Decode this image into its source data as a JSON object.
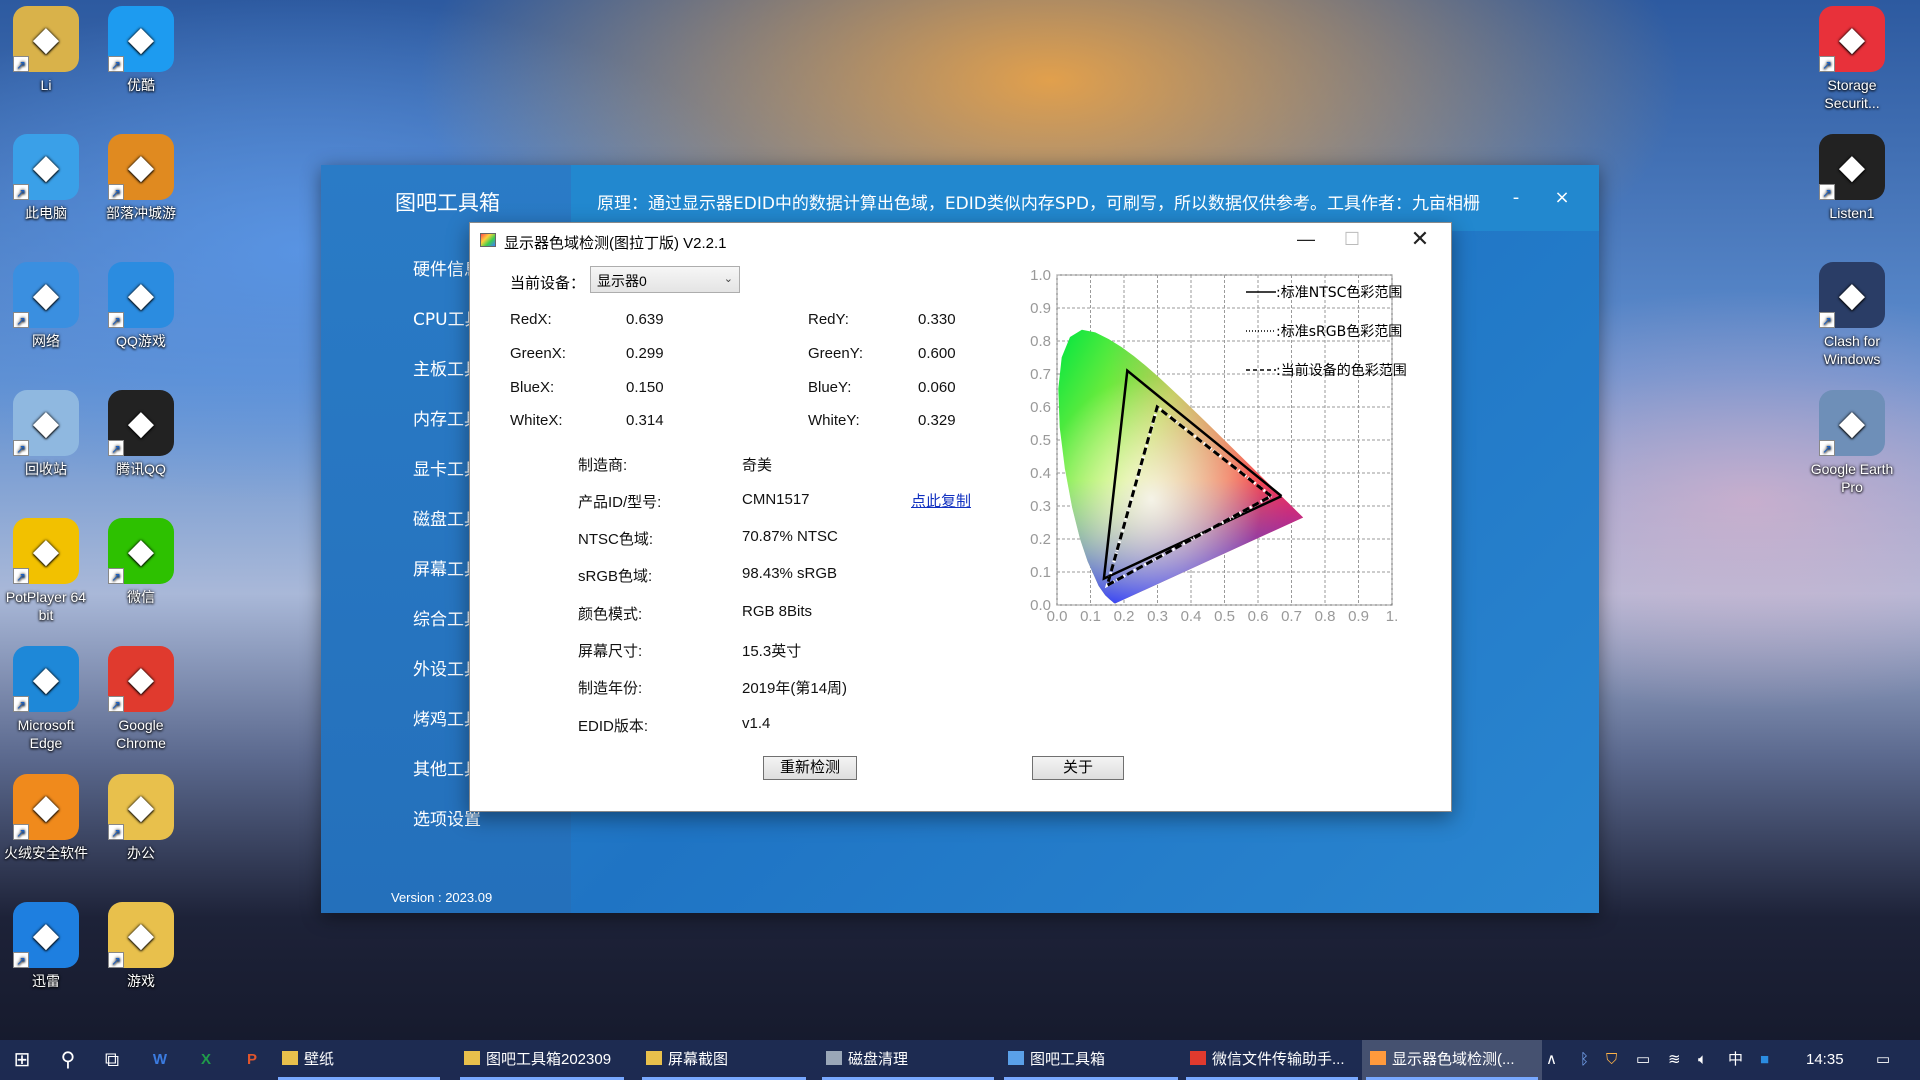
{
  "desktop": {
    "icons": [
      {
        "label": "Li",
        "icon": "user-folder-icon",
        "color": "#d9b24a"
      },
      {
        "label": "优酷",
        "icon": "youku-icon",
        "color": "#1d9bf0"
      },
      {
        "label": "此电脑",
        "icon": "computer-icon",
        "color": "#3aa0e8"
      },
      {
        "label": "部落冲城游",
        "icon": "game-icon",
        "color": "#e08a20"
      },
      {
        "label": "网络",
        "icon": "network-icon",
        "color": "#3a8fe0"
      },
      {
        "label": "QQ游戏",
        "icon": "qq-game-icon",
        "color": "#2b8ce0"
      },
      {
        "label": "回收站",
        "icon": "recycle-bin-icon",
        "color": "#8fb8e0"
      },
      {
        "label": "腾讯QQ",
        "icon": "qq-icon",
        "color": "#222222"
      },
      {
        "label": "PotPlayer 64 bit",
        "icon": "potplayer-icon",
        "color": "#f2c100"
      },
      {
        "label": "微信",
        "icon": "wechat-icon",
        "color": "#2dc100"
      },
      {
        "label": "Microsoft Edge",
        "icon": "edge-icon",
        "color": "#1e88d8"
      },
      {
        "label": "Google Chrome",
        "icon": "chrome-icon",
        "color": "#e03a2e"
      },
      {
        "label": "火绒安全软件",
        "icon": "huorong-icon",
        "color": "#f08a1c"
      },
      {
        "label": "办公",
        "icon": "folder-icon",
        "color": "#e8c04c"
      },
      {
        "label": "迅雷",
        "icon": "xunlei-icon",
        "color": "#1e7fe0"
      },
      {
        "label": "游戏",
        "icon": "folder-icon",
        "color": "#e8c04c"
      },
      {
        "label": "Storage Securit...",
        "icon": "storage-security-icon",
        "color": "#e8313a"
      },
      {
        "label": "Listen1",
        "icon": "listen1-icon",
        "color": "#222222"
      },
      {
        "label": "Clash for Windows",
        "icon": "clash-icon",
        "color": "#2a3d66"
      },
      {
        "label": "Google Earth Pro",
        "icon": "google-earth-icon",
        "color": "#6e8fb8"
      }
    ]
  },
  "toolbox": {
    "title": "图吧工具箱",
    "notice": "原理：通过显示器EDID中的数据计算出色域，EDID类似内存SPD，可刷写，所以数据仅供参考。工具作者：九亩相栅",
    "minimize": "-",
    "close": "×",
    "version": "Version : 2023.09",
    "nav": [
      "硬件信息",
      "CPU工具",
      "主板工具",
      "内存工具",
      "显卡工具",
      "磁盘工具",
      "屏幕工具",
      "综合工具",
      "外设工具",
      "烤鸡工具",
      "其他工具",
      "选项设置"
    ]
  },
  "dialog": {
    "title": "显示器色域检测(图拉丁版) V2.2.1",
    "controls": {
      "minimize": "—",
      "maximize": "☐",
      "close": "✕"
    },
    "device_label": "当前设备：",
    "device_value": "显示器0",
    "coords": [
      {
        "label": "RedX:",
        "value": "0.639"
      },
      {
        "label": "RedY:",
        "value": "0.330"
      },
      {
        "label": "GreenX:",
        "value": "0.299"
      },
      {
        "label": "GreenY:",
        "value": "0.600"
      },
      {
        "label": "BlueX:",
        "value": "0.150"
      },
      {
        "label": "BlueY:",
        "value": "0.060"
      },
      {
        "label": "WhiteX:",
        "value": "0.314"
      },
      {
        "label": "WhiteY:",
        "value": "0.329"
      }
    ],
    "info": [
      {
        "label": "制造商:",
        "value": "奇美"
      },
      {
        "label": "产品ID/型号:",
        "value": "CMN1517"
      },
      {
        "label": "NTSC色域:",
        "value": "70.87% NTSC"
      },
      {
        "label": "sRGB色域:",
        "value": "98.43% sRGB"
      },
      {
        "label": "颜色模式:",
        "value": "RGB 8Bits"
      },
      {
        "label": "屏幕尺寸:",
        "value": "15.3英寸"
      },
      {
        "label": "制造年份:",
        "value": "2019年(第14周)"
      },
      {
        "label": "EDID版本:",
        "value": "v1.4"
      }
    ],
    "copy_link": "点此复制",
    "recheck_button": "重新检测",
    "about_button": "关于"
  },
  "chart_data": {
    "type": "scatter",
    "title": "",
    "xlabel": "",
    "ylabel": "",
    "xlim": [
      0,
      1
    ],
    "ylim": [
      0,
      1
    ],
    "x_ticks": [
      "0.0",
      "0.1",
      "0.2",
      "0.3",
      "0.4",
      "0.5",
      "0.6",
      "0.7",
      "0.8",
      "0.9",
      "1."
    ],
    "y_ticks": [
      "0.0",
      "0.1",
      "0.2",
      "0.3",
      "0.4",
      "0.5",
      "0.6",
      "0.7",
      "0.8",
      "0.9",
      "1.0"
    ],
    "grid": true,
    "legend_position": "top-right",
    "series": [
      {
        "name": ":标准NTSC色彩范围",
        "style": "solid",
        "color": "#000000",
        "points": [
          [
            0.67,
            0.33
          ],
          [
            0.21,
            0.71
          ],
          [
            0.14,
            0.08
          ],
          [
            0.67,
            0.33
          ]
        ]
      },
      {
        "name": ":标准sRGB色彩范围",
        "style": "dotted",
        "color": "#ffffff",
        "points": [
          [
            0.64,
            0.33
          ],
          [
            0.3,
            0.6
          ],
          [
            0.15,
            0.06
          ],
          [
            0.64,
            0.33
          ]
        ]
      },
      {
        "name": ":当前设备的色彩范围",
        "style": "dashed",
        "color": "#000000",
        "points": [
          [
            0.639,
            0.33
          ],
          [
            0.299,
            0.6
          ],
          [
            0.15,
            0.06
          ],
          [
            0.639,
            0.33
          ]
        ]
      }
    ],
    "spectral_locus": [
      [
        0.1741,
        0.005
      ],
      [
        0.1738,
        0.0049
      ],
      [
        0.1733,
        0.0048
      ],
      [
        0.1726,
        0.0048
      ],
      [
        0.1714,
        0.0051
      ],
      [
        0.1689,
        0.0069
      ],
      [
        0.1644,
        0.0109
      ],
      [
        0.1566,
        0.0177
      ],
      [
        0.144,
        0.0297
      ],
      [
        0.1241,
        0.0578
      ],
      [
        0.0913,
        0.1327
      ],
      [
        0.0687,
        0.2007
      ],
      [
        0.0454,
        0.295
      ],
      [
        0.0235,
        0.4127
      ],
      [
        0.0082,
        0.5384
      ],
      [
        0.0039,
        0.6548
      ],
      [
        0.0139,
        0.7502
      ],
      [
        0.0389,
        0.812
      ],
      [
        0.0743,
        0.8338
      ],
      [
        0.1142,
        0.8262
      ],
      [
        0.1547,
        0.8059
      ],
      [
        0.1929,
        0.7816
      ],
      [
        0.2296,
        0.7543
      ],
      [
        0.2658,
        0.7243
      ],
      [
        0.3016,
        0.6923
      ],
      [
        0.3373,
        0.6589
      ],
      [
        0.3731,
        0.6245
      ],
      [
        0.4087,
        0.5896
      ],
      [
        0.4441,
        0.5547
      ],
      [
        0.4788,
        0.5202
      ],
      [
        0.5125,
        0.4866
      ],
      [
        0.5448,
        0.4544
      ],
      [
        0.5752,
        0.4242
      ],
      [
        0.6029,
        0.3965
      ],
      [
        0.627,
        0.3725
      ],
      [
        0.6482,
        0.3514
      ],
      [
        0.6658,
        0.334
      ],
      [
        0.6801,
        0.3197
      ],
      [
        0.6915,
        0.3083
      ],
      [
        0.7006,
        0.2993
      ],
      [
        0.7079,
        0.292
      ],
      [
        0.714,
        0.2859
      ],
      [
        0.7347,
        0.2653
      ]
    ]
  },
  "taskbar": {
    "tasks": [
      {
        "label": "壁纸",
        "icon": "folder-icon"
      },
      {
        "label": "图吧工具箱202309",
        "icon": "folder-icon"
      },
      {
        "label": "屏幕截图",
        "icon": "folder-icon"
      },
      {
        "label": "磁盘清理",
        "icon": "disk-cleanup-icon"
      },
      {
        "label": "图吧工具箱",
        "icon": "toolbox-icon"
      },
      {
        "label": "微信文件传输助手...",
        "icon": "chrome-icon"
      },
      {
        "label": "显示器色域检测(...",
        "icon": "gamut-icon"
      }
    ],
    "ime": "中",
    "time": "14:35"
  }
}
